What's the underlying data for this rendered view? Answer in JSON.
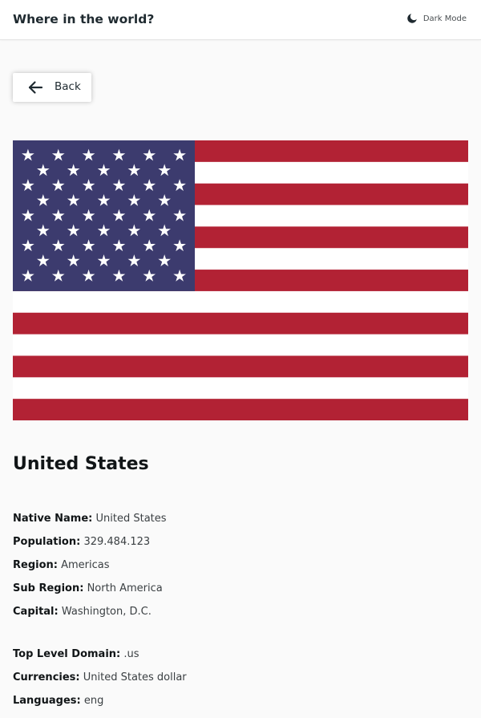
{
  "header": {
    "title": "Where in the world?",
    "theme_toggle_label": "Dark Mode",
    "theme_icon": "moon-icon"
  },
  "back_button": {
    "label": "Back",
    "icon": "arrow-left-icon"
  },
  "flag": {
    "description_colors": {
      "red": "#B22234",
      "white": "#FFFFFF",
      "blue": "#3C3B6E"
    }
  },
  "country": {
    "name": "United States",
    "details_primary": [
      {
        "label": "Native Name:",
        "value": "United States"
      },
      {
        "label": "Population:",
        "value": "329.484.123"
      },
      {
        "label": "Region:",
        "value": "Americas"
      },
      {
        "label": "Sub Region:",
        "value": "North America"
      },
      {
        "label": "Capital:",
        "value": "Washington, D.C."
      }
    ],
    "details_secondary": [
      {
        "label": "Top Level Domain:",
        "value": ".us"
      },
      {
        "label": "Currencies:",
        "value": "United States dollar"
      },
      {
        "label": "Languages:",
        "value": "eng"
      }
    ]
  }
}
